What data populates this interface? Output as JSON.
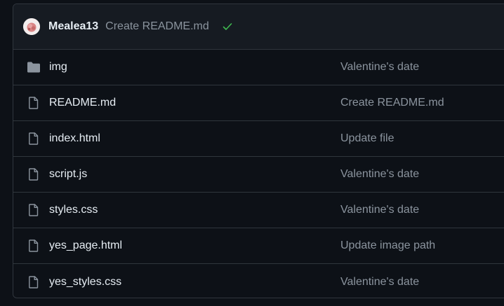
{
  "latest_commit": {
    "author": "Mealea13",
    "message": "Create README.md",
    "status_icon": "check-icon",
    "status_color": "#3fb950"
  },
  "files": [
    {
      "name": "img",
      "type": "folder",
      "icon": "folder-icon",
      "commit_message": "Valentine's date"
    },
    {
      "name": "README.md",
      "type": "file",
      "icon": "file-icon",
      "commit_message": "Create README.md"
    },
    {
      "name": "index.html",
      "type": "file",
      "icon": "file-icon",
      "commit_message": "Update file"
    },
    {
      "name": "script.js",
      "type": "file",
      "icon": "file-icon",
      "commit_message": "Valentine's date"
    },
    {
      "name": "styles.css",
      "type": "file",
      "icon": "file-icon",
      "commit_message": "Valentine's date"
    },
    {
      "name": "yes_page.html",
      "type": "file",
      "icon": "file-icon",
      "commit_message": "Update image path"
    },
    {
      "name": "yes_styles.css",
      "type": "file",
      "icon": "file-icon",
      "commit_message": "Valentine's date"
    }
  ],
  "colors": {
    "background": "#0d1117",
    "header_background": "#161b22",
    "border": "#30363d",
    "text_primary": "#e6edf3",
    "text_muted": "#8b949e",
    "folder_icon": "#8b949e"
  }
}
